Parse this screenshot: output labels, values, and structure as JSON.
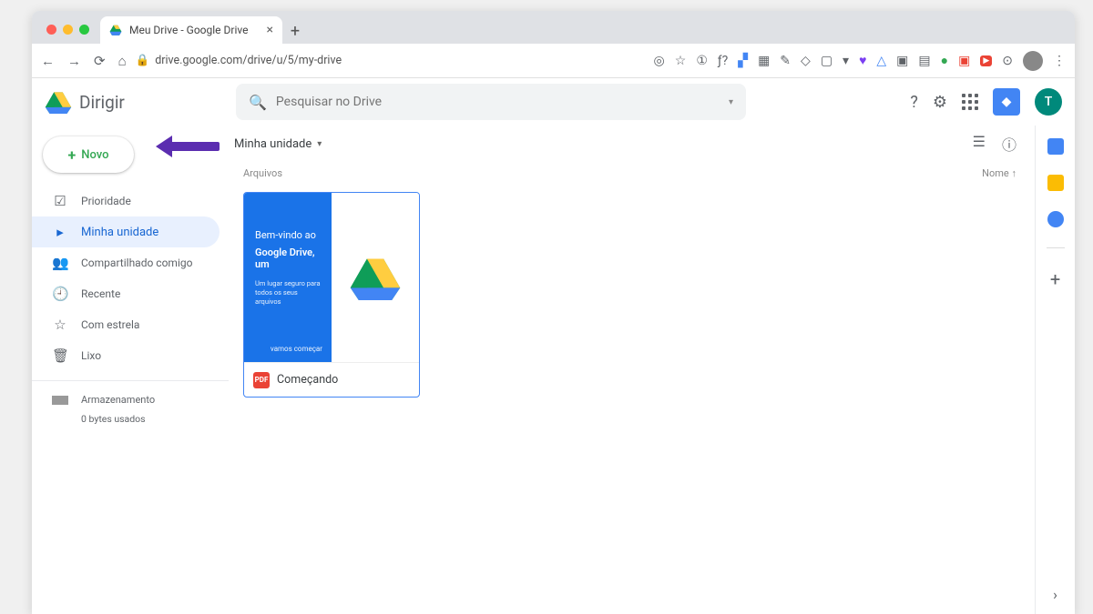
{
  "browser": {
    "tab_title": "Meu Drive - Google Drive",
    "url": "drive.google.com/drive/u/5/my-drive"
  },
  "header": {
    "app_name": "Dirigir",
    "search_placeholder": "Pesquisar no Drive",
    "user_initial": "T"
  },
  "new_button": {
    "label": "Novo"
  },
  "sidebar": {
    "items": [
      {
        "icon": "☑",
        "label": "Prioridade"
      },
      {
        "icon": "▸",
        "label": "Minha unidade"
      },
      {
        "icon": "👥",
        "label": "Compartilhado comigo"
      },
      {
        "icon": "🕘",
        "label": "Recente"
      },
      {
        "icon": "☆",
        "label": "Com estrela"
      },
      {
        "icon": "🗑",
        "label": "Lixo"
      }
    ],
    "storage_label": "Armazenamento",
    "storage_used": "0 bytes usados"
  },
  "main": {
    "breadcrumb": "Minha unidade",
    "section_label": "Arquivos",
    "sort_label": "Nome ↑"
  },
  "file": {
    "thumb_line1": "Bem-vindo ao",
    "thumb_line2": "Google Drive, um",
    "thumb_line3": "Um lugar seguro para todos os seus arquivos",
    "thumb_cta": "vamos começar",
    "name": "Começando",
    "badge": "PDF"
  }
}
